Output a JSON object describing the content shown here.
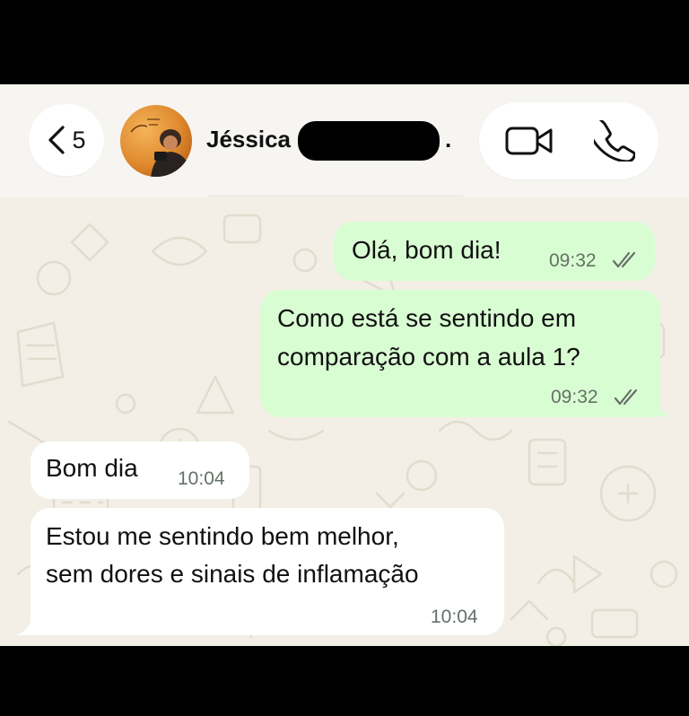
{
  "header": {
    "back_count": "5",
    "contact_name": "Jéssica C",
    "name_suffix": "."
  },
  "messages": [
    {
      "dir": "out",
      "text": "Olá, bom dia!",
      "time": "09:32",
      "status": "read"
    },
    {
      "dir": "out",
      "line1": "Como está se sentindo em",
      "line2": "comparação com a aula 1?",
      "time": "09:32",
      "status": "read"
    },
    {
      "dir": "in",
      "text": "Bom dia",
      "time": "10:04"
    },
    {
      "dir": "in",
      "line1": "Estou me sentindo bem melhor,",
      "line2": "sem dores e sinais de inflamação",
      "time": "10:04"
    }
  ],
  "colors": {
    "outgoing_bubble": "#d9fdd3",
    "incoming_bubble": "#ffffff",
    "chat_background": "#f3efe6",
    "read_ticks": "#667067"
  }
}
